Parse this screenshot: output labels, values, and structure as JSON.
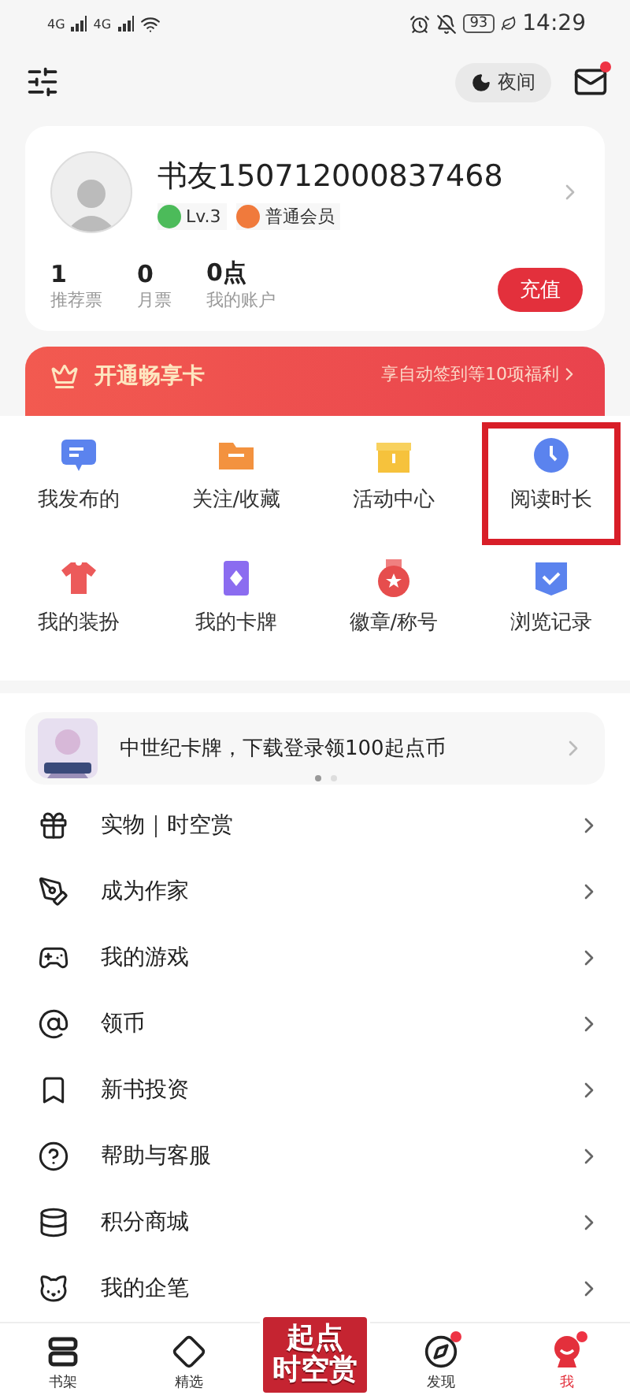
{
  "status_bar": {
    "network": [
      "4G",
      "4G"
    ],
    "battery": "93",
    "time": "14:29"
  },
  "header": {
    "night_mode": "夜间",
    "mail_unread": true
  },
  "profile": {
    "name": "书友150712000837468",
    "level": "Lv.3",
    "membership": "普通会员",
    "stats": [
      {
        "value": "1",
        "label": "推荐票"
      },
      {
        "value": "0",
        "label": "月票"
      },
      {
        "value": "0点",
        "label": "我的账户"
      }
    ],
    "recharge": "充值"
  },
  "vip_banner": {
    "title": "开通畅享卡",
    "subtitle": "享自动签到等10项福利"
  },
  "shortcuts": [
    {
      "kind": "chat",
      "label": "我发布的",
      "highlighted": false
    },
    {
      "kind": "folder",
      "label": "关注/收藏",
      "highlighted": false
    },
    {
      "kind": "gift",
      "label": "活动中心",
      "highlighted": false
    },
    {
      "kind": "clock",
      "label": "阅读时长",
      "highlighted": true
    },
    {
      "kind": "shirt",
      "label": "我的装扮",
      "highlighted": false
    },
    {
      "kind": "card",
      "label": "我的卡牌",
      "highlighted": false
    },
    {
      "kind": "medal",
      "label": "徽章/称号",
      "highlighted": false
    },
    {
      "kind": "check",
      "label": "浏览记录",
      "highlighted": false
    }
  ],
  "promo": {
    "text": "中世纪卡牌，下载登录领100起点币",
    "pages": [
      {
        "selected": true
      },
      {
        "selected": false
      }
    ]
  },
  "menu": [
    {
      "kind": "gift",
      "label": "实物｜时空赏"
    },
    {
      "kind": "pen",
      "label": "成为作家"
    },
    {
      "kind": "gamepad",
      "label": "我的游戏"
    },
    {
      "kind": "at",
      "label": "领币"
    },
    {
      "kind": "book",
      "label": "新书投资"
    },
    {
      "kind": "help",
      "label": "帮助与客服"
    },
    {
      "kind": "coins",
      "label": "积分商城"
    },
    {
      "kind": "cat",
      "label": "我的企笔"
    }
  ],
  "tab_bar": {
    "items": [
      {
        "kind": "shelf",
        "label": "书架",
        "selected": false,
        "dot": false
      },
      {
        "kind": "gem",
        "label": "精选",
        "selected": false,
        "dot": false
      },
      {
        "kind": "logo",
        "label": "起点",
        "label2": "时空赏"
      },
      {
        "kind": "compass",
        "label": "发现",
        "selected": false,
        "dot": true
      },
      {
        "kind": "me",
        "label": "我",
        "selected": true,
        "dot": true
      }
    ]
  }
}
